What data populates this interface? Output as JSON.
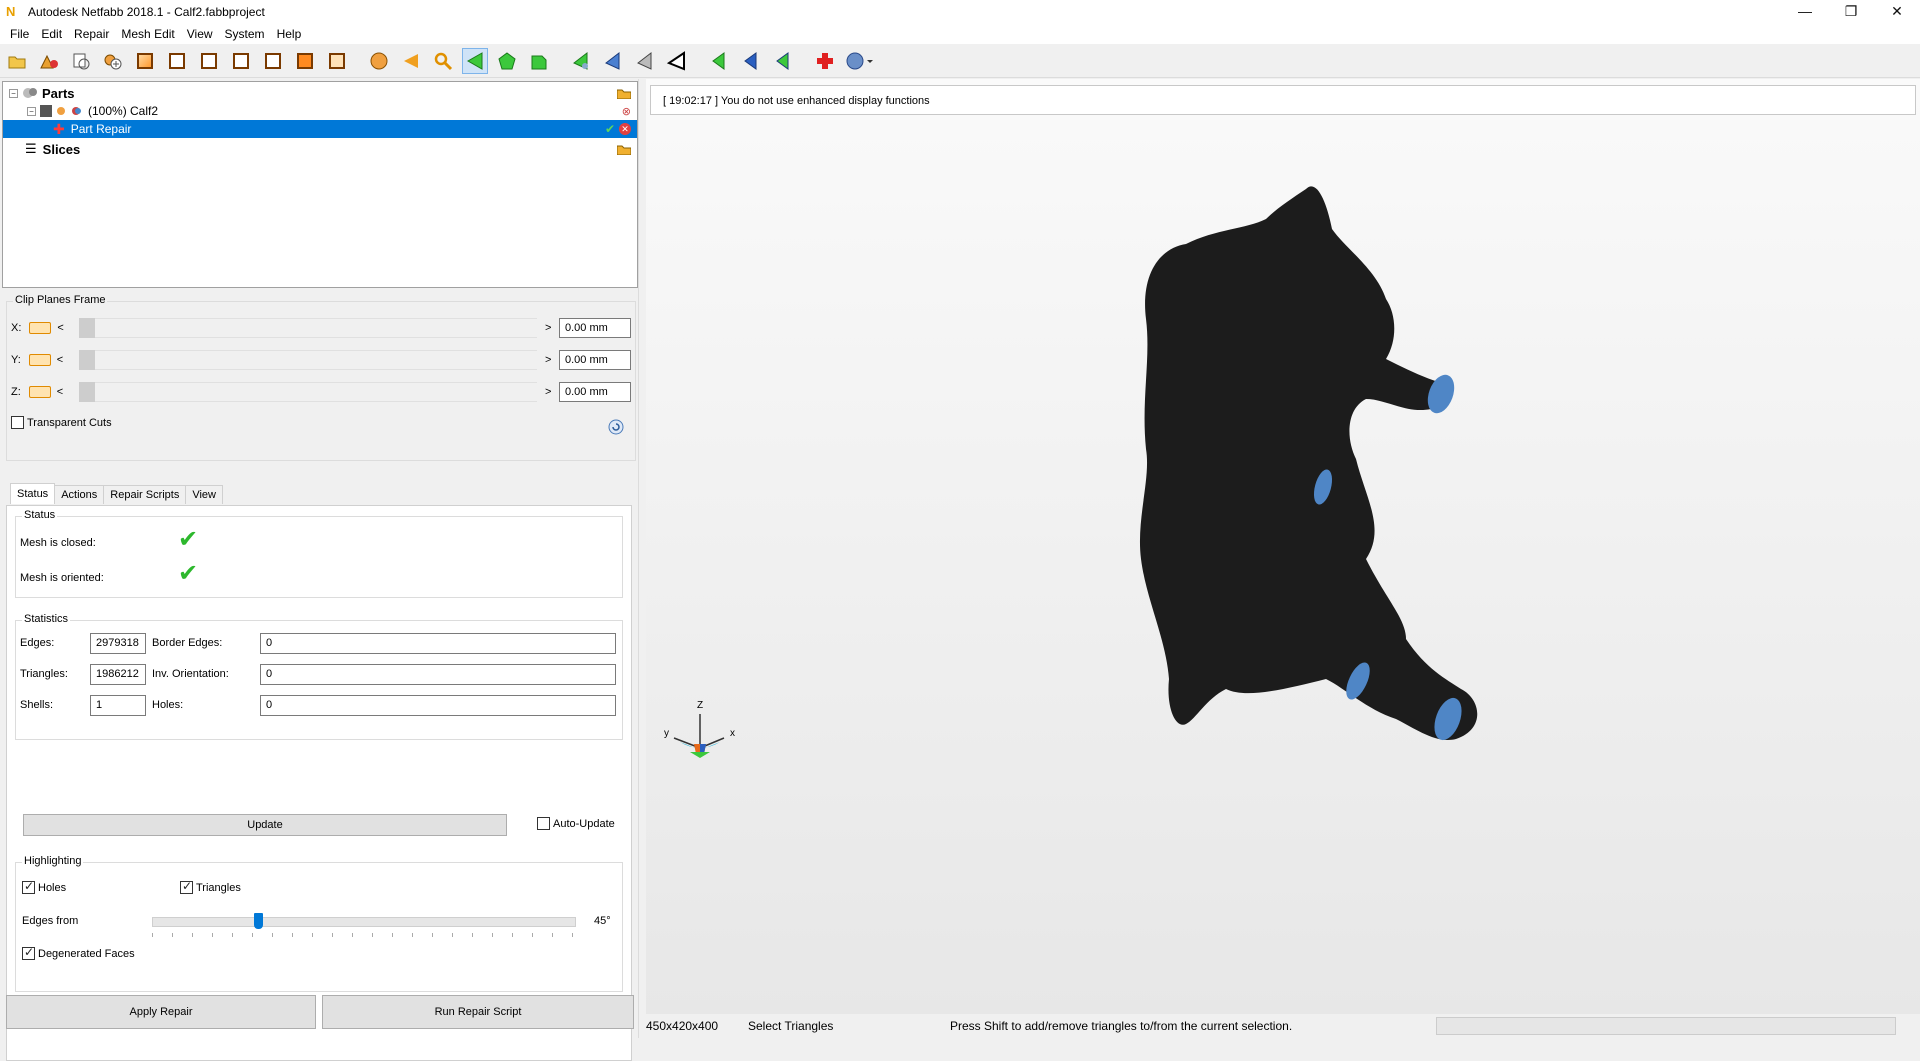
{
  "window": {
    "title": "Autodesk Netfabb 2018.1 - Calf2.fabbproject",
    "app_icon": "N",
    "minimize": "—",
    "restore": "❐",
    "close": "✕"
  },
  "menu": [
    "File",
    "Edit",
    "Repair",
    "Mesh Edit",
    "View",
    "System",
    "Help"
  ],
  "toolbar": {
    "icons": [
      "open-folder-icon",
      "add-part-icon",
      "copy-part-icon",
      "add-plus-icon",
      "view-front-icon",
      "view-back-icon",
      "view-left-icon",
      "view-right-icon",
      "view-top-icon",
      "view-bottom-icon",
      "view-iso-icon",
      "sphere-icon",
      "orange-triangle-icon",
      "zoom-icon",
      "select-triangles-icon",
      "select-surface-icon",
      "select-shell-icon",
      "green-tri-a-icon",
      "blue-tri-a-icon",
      "gray-tri-a-icon",
      "black-tri-icon",
      "green-tri-b-icon",
      "blue-tri-b-icon",
      "green-tri-c-icon",
      "repair-cross-icon",
      "help-icon"
    ]
  },
  "tree": {
    "parts_label": "Parts",
    "part_label": "(100%) Calf2",
    "repair_label": "Part Repair",
    "slices_label": "Slices"
  },
  "clip": {
    "title": "Clip Planes Frame",
    "rows": [
      {
        "axis": "X:",
        "value": "0.00 mm"
      },
      {
        "axis": "Y:",
        "value": "0.00 mm"
      },
      {
        "axis": "Z:",
        "value": "0.00 mm"
      }
    ],
    "transparent_label": "Transparent Cuts",
    "transparent_checked": false,
    "left_arrow": "<",
    "right_arrow": ">"
  },
  "tabs": [
    "Status",
    "Actions",
    "Repair Scripts",
    "View"
  ],
  "status": {
    "title": "Status",
    "closed_label": "Mesh is closed:",
    "oriented_label": "Mesh is oriented:",
    "check": "✔"
  },
  "statistics": {
    "title": "Statistics",
    "edges_label": "Edges:",
    "edges": "2979318",
    "border_label": "Border Edges:",
    "border": "0",
    "triangles_label": "Triangles:",
    "triangles": "1986212",
    "inv_label": "Inv. Orientation:",
    "inv": "0",
    "shells_label": "Shells:",
    "shells": "1",
    "holes_label": "Holes:",
    "holes": "0",
    "update_label": "Update",
    "auto_update_label": "Auto-Update"
  },
  "highlighting": {
    "title": "Highlighting",
    "holes_label": "Holes",
    "holes_checked": true,
    "triangles_label": "Triangles",
    "triangles_checked": true,
    "edges_from_label": "Edges from",
    "edges_from_value": "45°",
    "edges_from_fraction": 0.25,
    "degenerated_label": "Degenerated Faces",
    "degenerated_checked": true
  },
  "buttons": {
    "apply": "Apply Repair",
    "run_script": "Run Repair Script"
  },
  "log": {
    "message": "[ 19:02:17 ] You do not use enhanced display functions"
  },
  "axes": {
    "z": "Z",
    "y": "y",
    "x": "x"
  },
  "statusbar": {
    "dims": "450x420x400",
    "mode": "Select Triangles",
    "hint": "Press Shift to add/remove triangles to/from the current selection."
  },
  "colors": {
    "selection": "#0078d7",
    "model": "#1c1c1c",
    "highlight_blue": "#4f86c6",
    "check_green": "#2db82d"
  }
}
